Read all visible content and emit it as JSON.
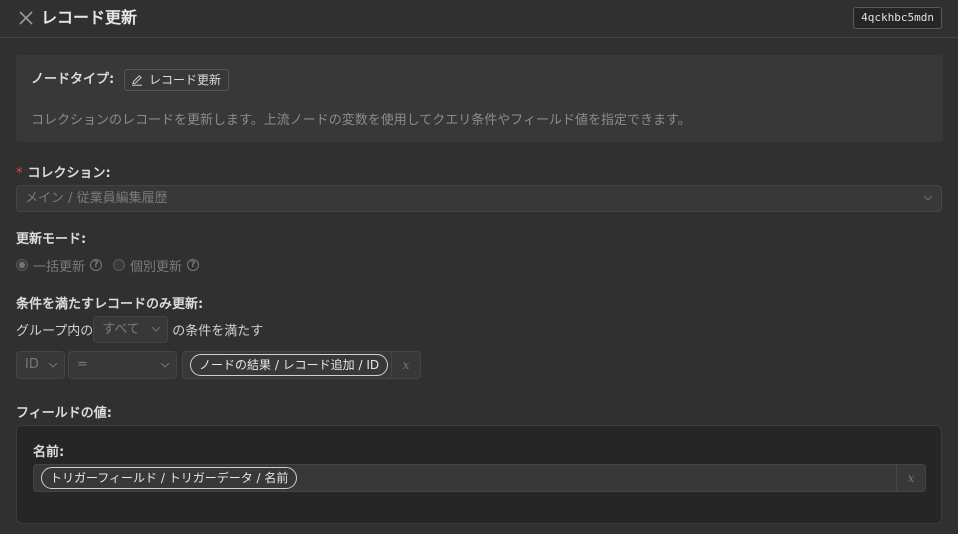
{
  "header": {
    "title": "レコード更新",
    "node_id": "4qckhbc5mdn"
  },
  "info": {
    "node_type_label": "ノードタイプ:",
    "node_type_value": "レコード更新",
    "description": "コレクションのレコードを更新します。上流ノードの変数を使用してクエリ条件やフィールド値を指定できます。"
  },
  "collection": {
    "required_mark": "*",
    "label": "コレクション:",
    "value": "メイン / 従業員編集履歴"
  },
  "update_mode": {
    "label": "更新モード:",
    "options": [
      {
        "label": "一括更新",
        "checked": true
      },
      {
        "label": "個別更新",
        "checked": false
      }
    ],
    "help_glyph": "?"
  },
  "filter": {
    "label": "条件を満たすレコードのみ更新:",
    "group_prefix": "グループ内の",
    "group_select": "すべて",
    "group_suffix": "の条件を満たす",
    "condition": {
      "field": "ID",
      "operator": "=",
      "value_tag": "ノードの結果 / レコード追加 / ID",
      "clear": "x"
    }
  },
  "field_values": {
    "label": "フィールドの値:",
    "fields": [
      {
        "label": "名前:",
        "value_tag": "トリガーフィールド / トリガーデータ / 名前",
        "clear": "x"
      }
    ]
  }
}
